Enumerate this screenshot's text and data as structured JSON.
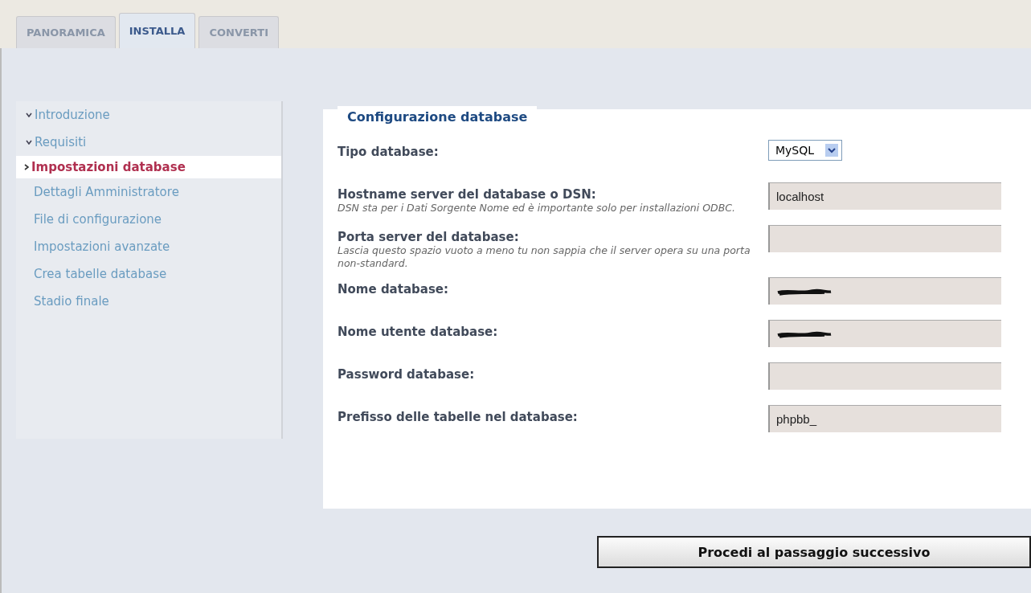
{
  "tabs": [
    {
      "label": "PANORAMICA",
      "selected": false
    },
    {
      "label": "INSTALLA",
      "selected": true
    },
    {
      "label": "CONVERTI",
      "selected": false
    }
  ],
  "sidebar": {
    "items": [
      {
        "label": "Introduzione",
        "done": true,
        "selected": false
      },
      {
        "label": "Requisiti",
        "done": true,
        "selected": false
      },
      {
        "label": "Impostazioni database",
        "done": false,
        "selected": true
      },
      {
        "label": "Dettagli Amministratore",
        "done": false,
        "selected": false
      },
      {
        "label": "File di configurazione",
        "done": false,
        "selected": false
      },
      {
        "label": "Impostazioni avanzate",
        "done": false,
        "selected": false
      },
      {
        "label": "Crea tabelle database",
        "done": false,
        "selected": false
      },
      {
        "label": "Stadio finale",
        "done": false,
        "selected": false
      }
    ]
  },
  "form": {
    "legend": "Configurazione database",
    "fields": [
      {
        "kind": "select",
        "label": "Tipo database:",
        "value": "MySQL"
      },
      {
        "kind": "text",
        "label": "Hostname server del database o DSN:",
        "hint": "DSN sta per i Dati Sorgente Nome ed è importante solo per installazioni ODBC.",
        "value": "localhost"
      },
      {
        "kind": "text",
        "label": "Porta server del database:",
        "hint": "Lascia questo spazio vuoto a meno tu non sappia che il server opera su una porta non-standard."
      },
      {
        "kind": "text",
        "label": "Nome database:",
        "redacted": true
      },
      {
        "kind": "text",
        "label": "Nome utente database:",
        "redacted": true
      },
      {
        "kind": "text",
        "label": "Password database:"
      },
      {
        "kind": "text",
        "label": "Prefisso delle tabelle nel database:",
        "value": "phpbb_"
      }
    ]
  },
  "submit_button": "Procedi al passaggio successivo"
}
